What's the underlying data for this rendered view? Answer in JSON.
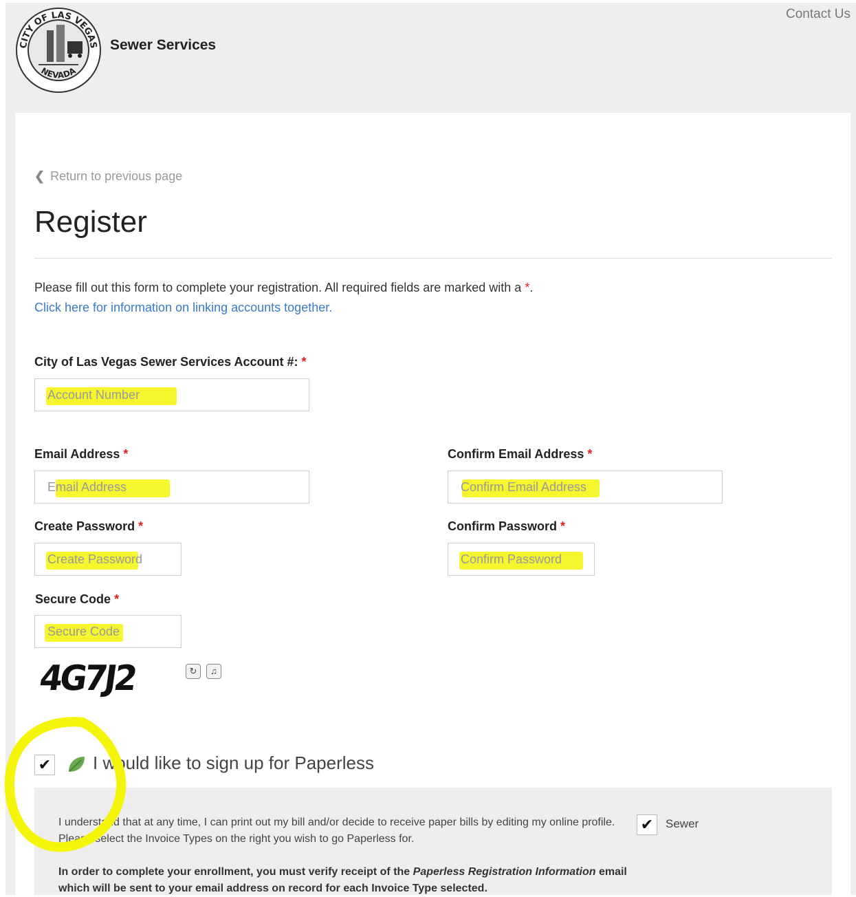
{
  "header": {
    "brand_name": "Sewer Services",
    "contact_link": "Contact Us",
    "seal_text": [
      "CITY OF LAS VEGAS",
      "NEVADA"
    ]
  },
  "nav": {
    "back_link": "Return to previous page"
  },
  "page": {
    "title": "Register",
    "intro_text": "Please fill out this form to complete your registration. All required fields are marked with a",
    "required_marker": "*",
    "intro_tail": ".",
    "link_text": "Click here for information on linking accounts together."
  },
  "form": {
    "account": {
      "label": "City of Las Vegas Sewer Services Account #:",
      "placeholder": "Account Number",
      "value": ""
    },
    "email": {
      "label": "Email Address",
      "placeholder": "Email Address",
      "value": ""
    },
    "confirm_email": {
      "label": "Confirm Email Address",
      "placeholder": "Confirm Email Address",
      "value": ""
    },
    "password": {
      "label": "Create Password",
      "placeholder": "Create Password",
      "value": ""
    },
    "confirm_password": {
      "label": "Confirm Password",
      "placeholder": "Confirm Password",
      "value": ""
    },
    "secure_code": {
      "label": "Secure Code",
      "placeholder": "Secure Code",
      "value": ""
    },
    "captcha": {
      "text": "4G7J2"
    }
  },
  "paperless": {
    "checkbox_checked": true,
    "label": "I would like to sign up for Paperless",
    "note": "I understand that at any time, I can print out my bill and/or decide to receive paper bills by editing my online profile. Please select the Invoice Types on the right you wish to go Paperless for.",
    "note2_prefix": "In order to complete your enrollment, you must verify receipt of the ",
    "note2_emph": "Paperless Registration Information",
    "note2_suffix": " email which will be sent to your email address on record for each Invoice Type selected.",
    "invoice_type": {
      "label": "Sewer",
      "checked": true
    }
  },
  "colors": {
    "highlight": "#f5f50a",
    "required": "#e02020",
    "link": "#3a7bc8",
    "leaf": "#6aa84f"
  },
  "icons": [
    "city-seal-icon",
    "chevron-left-icon",
    "refresh-icon",
    "audio-icon",
    "checkmark-icon",
    "leaf-icon"
  ]
}
